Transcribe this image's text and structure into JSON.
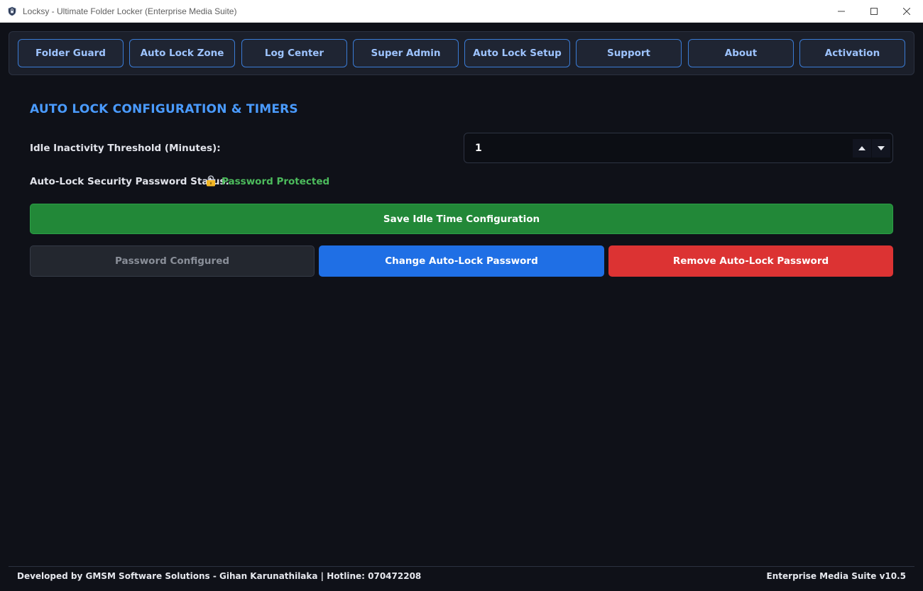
{
  "window": {
    "title": "Locksy - Ultimate Folder Locker (Enterprise Media Suite)",
    "app_icon": "shield-lock-icon",
    "controls": [
      "minimize-icon",
      "maximize-icon",
      "close-icon"
    ]
  },
  "nav": {
    "tabs": [
      {
        "label": "Folder Guard"
      },
      {
        "label": "Auto Lock Zone"
      },
      {
        "label": "Log Center"
      },
      {
        "label": "Super Admin"
      },
      {
        "label": "Auto Lock Setup"
      },
      {
        "label": "Support"
      },
      {
        "label": "About"
      },
      {
        "label": "Activation"
      }
    ]
  },
  "main": {
    "section_title": "AUTO LOCK CONFIGURATION & TIMERS",
    "idle_label": "Idle Inactivity Threshold (Minutes):",
    "idle_value": "1",
    "status_label": "Auto-Lock Security Password Status:",
    "status_icon": "lock-icon",
    "status_text": "Password Protected",
    "save_button": "Save Idle Time Configuration",
    "configured_button": "Password Configured",
    "change_button": "Change Auto-Lock Password",
    "remove_button": "Remove Auto-Lock Password"
  },
  "footer": {
    "left": "Developed by GMSM Software Solutions - Gihan Karunathilaka | Hotline: 070472208",
    "right": "Enterprise Media Suite v10.5"
  },
  "colors": {
    "background": "#0f1118",
    "accent_blue": "#4a9bff",
    "save_green": "#228838",
    "status_green": "#4cbb5c",
    "change_blue": "#1f6fe5",
    "remove_red": "#dc3333"
  }
}
